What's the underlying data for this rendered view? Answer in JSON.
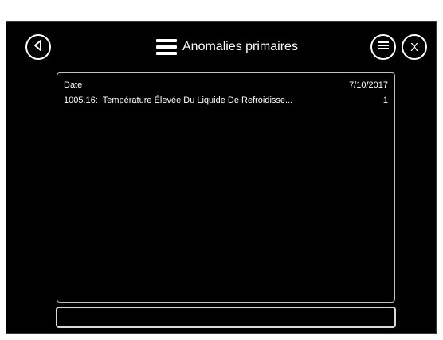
{
  "header": {
    "title": "Anomalies primaires",
    "close_label": "X"
  },
  "list": {
    "header": {
      "label": "Date",
      "value": "7/10/2017"
    },
    "rows": [
      {
        "code": "1005.16:",
        "description": "Température Élevée Du Liquide De Refroidisse...",
        "count": "1"
      }
    ]
  },
  "input": {
    "value": ""
  }
}
